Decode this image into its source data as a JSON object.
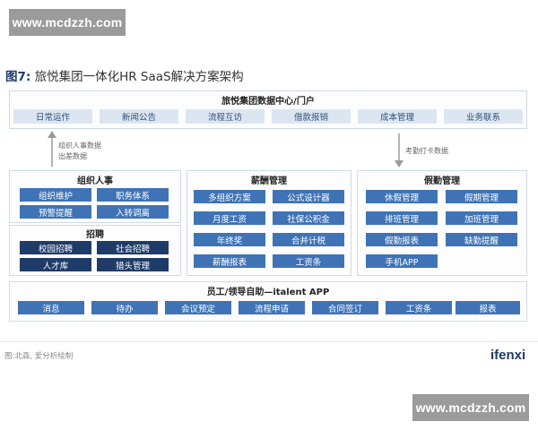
{
  "watermark": {
    "text": "www.mcdzzh.com"
  },
  "figure": {
    "title_num": "图7:",
    "title_text": " 旅悦集团一体化HR SaaS解决方案架构"
  },
  "portal": {
    "header": "旅悦集团数据中心/门户",
    "items": [
      "日常运作",
      "新闻公告",
      "流程互访",
      "借款报销",
      "成本管理",
      "业务联系"
    ]
  },
  "notes": {
    "left": [
      "组织人事数据",
      "出差数据"
    ],
    "right": "考勤打卡数据"
  },
  "org": {
    "header": "组织人事",
    "items": [
      "组织维护",
      "职务体系",
      "预警提醒",
      "入转调离"
    ]
  },
  "recruit": {
    "header": "招聘",
    "items": [
      "校园招聘",
      "社会招聘",
      "人才库",
      "猎头管理"
    ]
  },
  "payroll": {
    "header": "薪酬管理",
    "items": [
      "多组织方案",
      "公式设计器",
      "月度工资",
      "社保公积金",
      "年终奖",
      "合并计税",
      "薪酬报表",
      "工资条"
    ]
  },
  "attendance": {
    "header": "假勤管理",
    "items": [
      "休假管理",
      "假期管理",
      "排班管理",
      "加班管理",
      "假勤报表",
      "缺勤提醒",
      "手机APP"
    ]
  },
  "app": {
    "header": "员工/领导自助—italent APP",
    "items": [
      "消息",
      "待办",
      "会议预定",
      "流程申请",
      "合同签订",
      "工资条",
      "报表"
    ]
  },
  "footer": {
    "source": "图:北森, 爱分析绘制",
    "logo": "ifenxi"
  },
  "colors": {
    "dark_navy": "#1f3b68",
    "mid_blue": "#3f73b6",
    "light_blue": "#dce6f1",
    "border": "#cfdae6"
  }
}
